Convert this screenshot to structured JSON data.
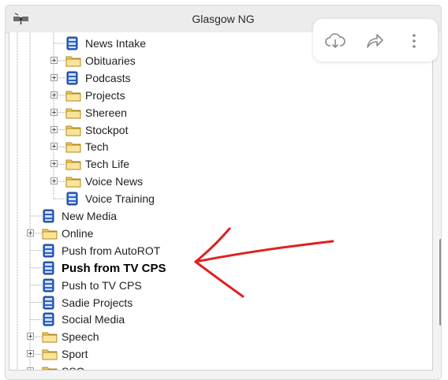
{
  "window": {
    "title": "Glasgow NG"
  },
  "toolbar": {
    "buttons": [
      {
        "icon": "download-cloud-icon"
      },
      {
        "icon": "share-icon"
      },
      {
        "icon": "more-icon"
      }
    ]
  },
  "tree": {
    "items": [
      {
        "label": "News Intake",
        "icon": "database-icon",
        "depth": 2,
        "expandable": false
      },
      {
        "label": "Obituaries",
        "icon": "folder-icon",
        "depth": 2,
        "expandable": true
      },
      {
        "label": "Podcasts",
        "icon": "database-icon",
        "depth": 2,
        "expandable": true
      },
      {
        "label": "Projects",
        "icon": "folder-icon",
        "depth": 2,
        "expandable": true
      },
      {
        "label": "Shereen",
        "icon": "folder-icon",
        "depth": 2,
        "expandable": true
      },
      {
        "label": "Stockpot",
        "icon": "folder-icon",
        "depth": 2,
        "expandable": true
      },
      {
        "label": "Tech",
        "icon": "folder-icon",
        "depth": 2,
        "expandable": true
      },
      {
        "label": "Tech Life",
        "icon": "folder-icon",
        "depth": 2,
        "expandable": true
      },
      {
        "label": "Voice News",
        "icon": "folder-icon",
        "depth": 2,
        "expandable": true
      },
      {
        "label": "Voice Training",
        "icon": "database-icon",
        "depth": 2,
        "expandable": false
      },
      {
        "label": "New Media",
        "icon": "database-icon",
        "depth": 1,
        "expandable": false
      },
      {
        "label": "Online",
        "icon": "folder-icon",
        "depth": 1,
        "expandable": true
      },
      {
        "label": "Push from AutoROT",
        "icon": "database-icon",
        "depth": 1,
        "expandable": false
      },
      {
        "label": "Push from TV CPS",
        "icon": "database-icon",
        "depth": 1,
        "expandable": false,
        "bold": true
      },
      {
        "label": "Push to TV CPS",
        "icon": "database-icon",
        "depth": 1,
        "expandable": false
      },
      {
        "label": "Sadie Projects",
        "icon": "database-icon",
        "depth": 1,
        "expandable": false
      },
      {
        "label": "Social Media",
        "icon": "database-icon",
        "depth": 1,
        "expandable": false
      },
      {
        "label": "Speech",
        "icon": "folder-icon",
        "depth": 1,
        "expandable": true
      },
      {
        "label": "Sport",
        "icon": "folder-icon",
        "depth": 1,
        "expandable": true
      },
      {
        "label": "SSO",
        "icon": "folder-icon",
        "depth": 1,
        "expandable": true
      }
    ]
  },
  "colors": {
    "folder": "#f2cf5a",
    "database": "#2f63c4",
    "annotation_arrow": "#e02020"
  }
}
